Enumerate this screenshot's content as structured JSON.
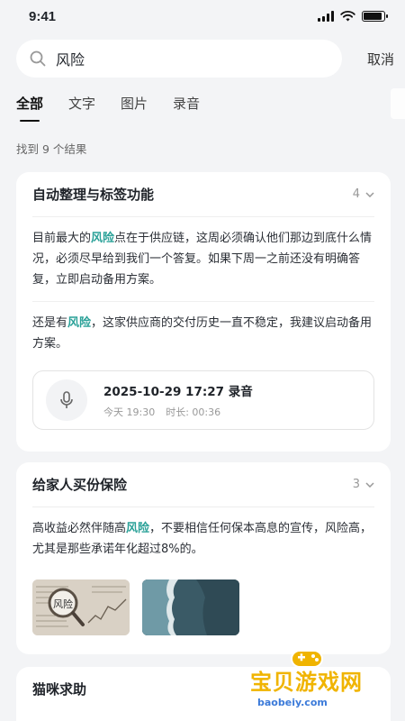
{
  "status": {
    "time": "9:41",
    "battery_level": 0.9
  },
  "search": {
    "query": "风险",
    "cancel_label": "取消"
  },
  "tabs": [
    {
      "label": "全部",
      "active": true
    },
    {
      "label": "文字",
      "active": false
    },
    {
      "label": "图片",
      "active": false
    },
    {
      "label": "录音",
      "active": false
    }
  ],
  "result_count": "找到 9 个结果",
  "cards": [
    {
      "title": "自动整理与标签功能",
      "count": "4",
      "p1": {
        "a": "目前最大的",
        "hl": "风险",
        "b": "点在于供应链，这周必须确认他们那边到底什么情况，必须尽早给到我们一个答复。如果下周一之前还没有明确答复，立即启动备用方案。"
      },
      "p2": {
        "a": "还是有",
        "hl": "风险",
        "b": "，这家供应商的交付历史一直不稳定，我建议启动备用方案。"
      },
      "audio": {
        "title": "2025-10-29 17:27 录音",
        "date": "今天 19:30",
        "duration": "时长: 00:36"
      }
    },
    {
      "title": "给家人买份保险",
      "count": "3",
      "p1": {
        "a": "高收益必然伴随高",
        "hl": "风险",
        "b": "，不要相信任何保本高息的宣传，风险高，尤其是那些承诺年化超过8%的。"
      },
      "thumb_label": "风险"
    },
    {
      "title": "猫咪求助"
    }
  ],
  "watermark": {
    "title": "宝贝游戏网",
    "url": "baobeiy.com"
  }
}
